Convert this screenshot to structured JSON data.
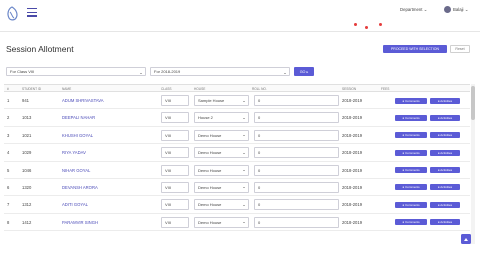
{
  "header": {
    "department": "Department",
    "department_chevron": "⌄",
    "username": "Balaji",
    "username_chevron": "⌄"
  },
  "page": {
    "title": "Session Allotment",
    "primary_action": "PROCEED WITH SELECTION",
    "secondary_action": "Reset"
  },
  "filters": {
    "class": "For Class VIII",
    "session": "For 2018-2019",
    "go": "GO ▸"
  },
  "table": {
    "headers": [
      "#",
      "STUDENT ID",
      "NAME",
      "CLASS",
      "HOUSE",
      "ROLL NO.",
      "SESSION",
      "FEES"
    ],
    "action_labels": [
      "Comments",
      "Activities"
    ],
    "rows": [
      {
        "num": "1",
        "id": "941",
        "name": "ADUM SHRIVASTAVA",
        "cls": "VIII",
        "house": "Sample House",
        "roll": "0",
        "session": "2018-2019"
      },
      {
        "num": "2",
        "id": "1013",
        "name": "DEEPALI NAHAR",
        "cls": "VIII",
        "house": "House 2",
        "roll": "0",
        "session": "2018-2019"
      },
      {
        "num": "3",
        "id": "1021",
        "name": "KHUSHI GOYAL",
        "cls": "VIII",
        "house": "Demo House",
        "roll": "0",
        "session": "2018-2019"
      },
      {
        "num": "4",
        "id": "1029",
        "name": "RIYA YADAV",
        "cls": "VIII",
        "house": "Demo House",
        "roll": "0",
        "session": "2018-2019"
      },
      {
        "num": "5",
        "id": "1046",
        "name": "NIHAR GOYAL",
        "cls": "VIII",
        "house": "Demo House",
        "roll": "0",
        "session": "2018-2019"
      },
      {
        "num": "6",
        "id": "1320",
        "name": "DEVANSH ARORA",
        "cls": "VIII",
        "house": "Demo House",
        "roll": "0",
        "session": "2018-2019"
      },
      {
        "num": "7",
        "id": "1312",
        "name": "ADITI GOYAL",
        "cls": "VIII",
        "house": "Demo House",
        "roll": "0",
        "session": "2018-2019"
      },
      {
        "num": "8",
        "id": "1412",
        "name": "PARAMVIR SINGH",
        "cls": "VIII",
        "house": "Demo House",
        "roll": "0",
        "session": "2018-2019"
      }
    ]
  },
  "colors": {
    "accent": "#5b5bd6",
    "notification": "#e53c3c",
    "name_link": "#4a4ab8"
  },
  "icons": {
    "logo": "app-logo-icon",
    "menu": "hamburger-menu-icon",
    "scroll_top": "scroll-to-top-icon"
  }
}
